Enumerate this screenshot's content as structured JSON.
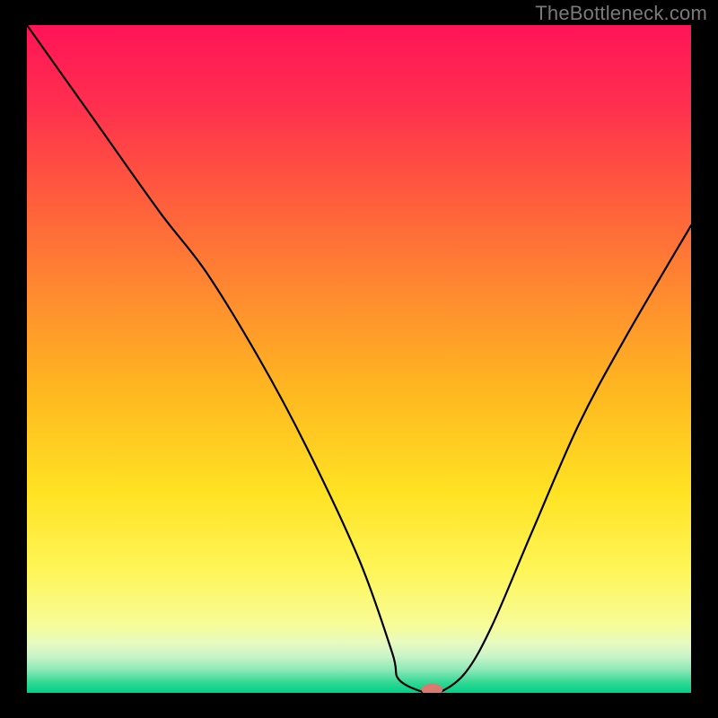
{
  "watermark": "TheBottleneck.com",
  "chart_data": {
    "type": "line",
    "title": "",
    "xlabel": "",
    "ylabel": "",
    "xlim": [
      0,
      100
    ],
    "ylim": [
      0,
      100
    ],
    "grid": false,
    "legend": false,
    "series": [
      {
        "name": "bottleneck-curve",
        "x": [
          0,
          10,
          20,
          27,
          35,
          42,
          50,
          55,
          56,
          60,
          62,
          66,
          70,
          76,
          83,
          90,
          100
        ],
        "y": [
          100,
          86,
          72,
          63,
          50,
          37,
          20,
          6,
          2,
          0,
          0,
          3,
          10,
          24,
          40,
          53,
          70
        ]
      }
    ],
    "marker": {
      "x": 61,
      "y": 0.5,
      "rx": 1.6,
      "ry": 0.9,
      "color": "#d87a70"
    },
    "background_gradient": {
      "stops": [
        {
          "offset": 0.0,
          "color": "#ff1458"
        },
        {
          "offset": 0.12,
          "color": "#ff2f4e"
        },
        {
          "offset": 0.25,
          "color": "#ff5a3e"
        },
        {
          "offset": 0.4,
          "color": "#ff8a30"
        },
        {
          "offset": 0.55,
          "color": "#ffb820"
        },
        {
          "offset": 0.7,
          "color": "#ffe223"
        },
        {
          "offset": 0.82,
          "color": "#fff65a"
        },
        {
          "offset": 0.9,
          "color": "#f6fc9a"
        },
        {
          "offset": 0.925,
          "color": "#e7fac0"
        },
        {
          "offset": 0.945,
          "color": "#c9f4c8"
        },
        {
          "offset": 0.965,
          "color": "#8de9b8"
        },
        {
          "offset": 0.985,
          "color": "#30d893"
        },
        {
          "offset": 1.0,
          "color": "#00cf87"
        }
      ]
    }
  }
}
